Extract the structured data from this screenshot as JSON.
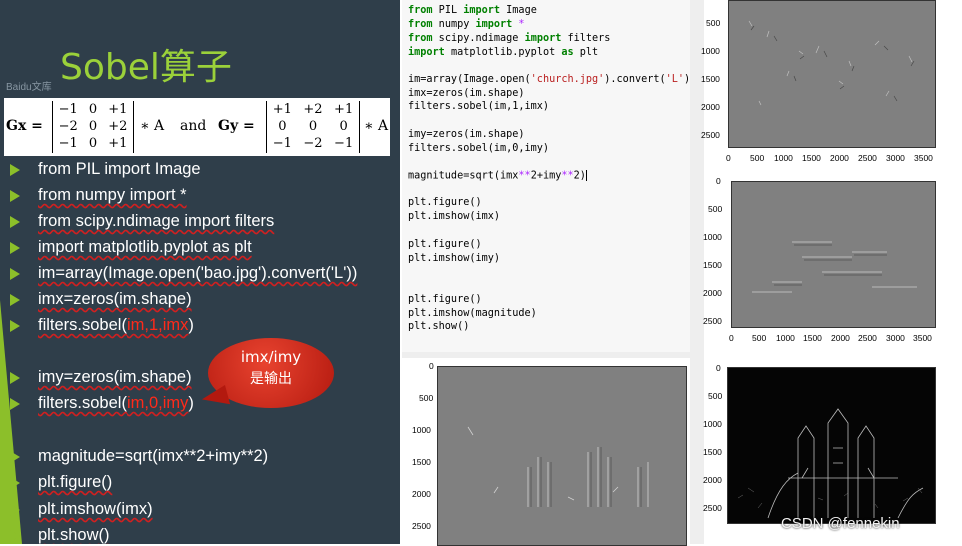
{
  "slide": {
    "title": "Sobel算子",
    "watermark_small": "Baidu文库",
    "formula": {
      "gx_label": "Gx =",
      "gx_matrix": [
        [
          "−1",
          "0",
          "+1"
        ],
        [
          "−2",
          "0",
          "+2"
        ],
        [
          "−1",
          "0",
          "+1"
        ]
      ],
      "times_a_1": "∗ A",
      "and_text": "and",
      "gy_label": "Gy =",
      "gy_matrix": [
        [
          "+1",
          "+2",
          "+1"
        ],
        [
          "0",
          "0",
          "0"
        ],
        [
          "−1",
          "−2",
          "−1"
        ]
      ],
      "times_a_2": "∗ A"
    },
    "bullets": [
      "from PIL import Image",
      "from numpy import *",
      "from scipy.ndimage import filters",
      "import matplotlib.pyplot as plt",
      "im=array(Image.open('bao.jpg').convert('L'))",
      "imx=zeros(im.shape)",
      "filters.sobel(",
      "im,1,imx",
      ")",
      "imy=zeros(im.shape)",
      "filters.sobel(",
      "im,0,imy",
      ")",
      "magnitude=sqrt(imx**2+imy**2)",
      "plt.figure()",
      "plt.imshow(imx)",
      "plt.show()"
    ],
    "callout": {
      "line1": "imx/imy",
      "line2": "是输出"
    }
  },
  "code": {
    "l1a": "from",
    "l1b": " PIL ",
    "l1c": "import",
    "l1d": " Image",
    "l2a": "from",
    "l2b": " numpy ",
    "l2c": "import",
    "l2d": " *",
    "l3a": "from",
    "l3b": " scipy.ndimage ",
    "l3c": "import",
    "l3d": " filters",
    "l4a": "import",
    "l4b": " matplotlib.pyplot ",
    "l4c": "as",
    "l4d": " plt",
    "l5a": "im=array(Image.open(",
    "l5b": "'church.jpg'",
    "l5c": ").convert(",
    "l5d": "'L'",
    "l5e": "))",
    "l6": "imx=zeros(im.shape)",
    "l7": "filters.sobel(im,1,imx)",
    "l8": "imy=zeros(im.shape)",
    "l9": "filters.sobel(im,0,imy)",
    "l10a": "magnitude=sqrt(imx",
    "l10b": "**",
    "l10c": "2+imy",
    "l10d": "**",
    "l10e": "2)",
    "l11": "plt.figure()",
    "l12": "plt.imshow(imx)",
    "l13": "plt.figure()",
    "l14": "plt.imshow(imy)",
    "l15": "plt.figure()",
    "l16": "plt.imshow(magnitude)",
    "l17": "plt.show()"
  },
  "plots": {
    "top_right": {
      "yticks": [
        "500",
        "1000",
        "1500",
        "2000",
        "2500"
      ],
      "xticks": [
        "0",
        "500",
        "1000",
        "1500",
        "2000",
        "2500",
        "3000",
        "3500"
      ]
    },
    "mid_right": {
      "yticks": [
        "0",
        "500",
        "1000",
        "1500",
        "2000",
        "2500"
      ],
      "xticks": [
        "0",
        "500",
        "1000",
        "1500",
        "2000",
        "2500",
        "3000",
        "3500"
      ]
    },
    "bottom_right": {
      "yticks": [
        "0",
        "500",
        "1000",
        "1500",
        "2000",
        "2500"
      ]
    },
    "bottom_mid": {
      "yticks": [
        "0",
        "500",
        "1000",
        "1500",
        "2000",
        "2500"
      ]
    }
  },
  "watermark": "CSDN @fennekin",
  "colors": {
    "slide_bg": "#2f3e4a",
    "title_green": "#9bd13a",
    "bullet_green": "#8cbf2a",
    "code_red": "#ff2a1a",
    "keyword": "#008000"
  }
}
